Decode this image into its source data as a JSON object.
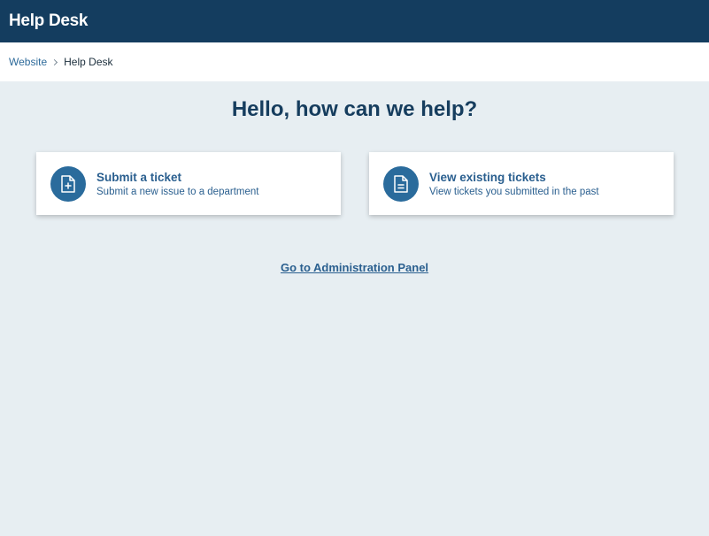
{
  "header": {
    "title": "Help Desk",
    "background": "#143d5f"
  },
  "breadcrumb": {
    "items": [
      {
        "label": "Website"
      },
      {
        "label": "Help Desk"
      }
    ]
  },
  "main": {
    "heading": "Hello, how can we help?",
    "cards": [
      {
        "icon": "file-plus-icon",
        "title": "Submit a ticket",
        "subtitle": "Submit a new issue to a department"
      },
      {
        "icon": "file-text-icon",
        "title": "View existing tickets",
        "subtitle": "View tickets you submitted in the past"
      }
    ],
    "admin_link": "Go to Administration Panel"
  },
  "colors": {
    "accent": "#2a6b9c",
    "page_background": "#e7eef2"
  }
}
